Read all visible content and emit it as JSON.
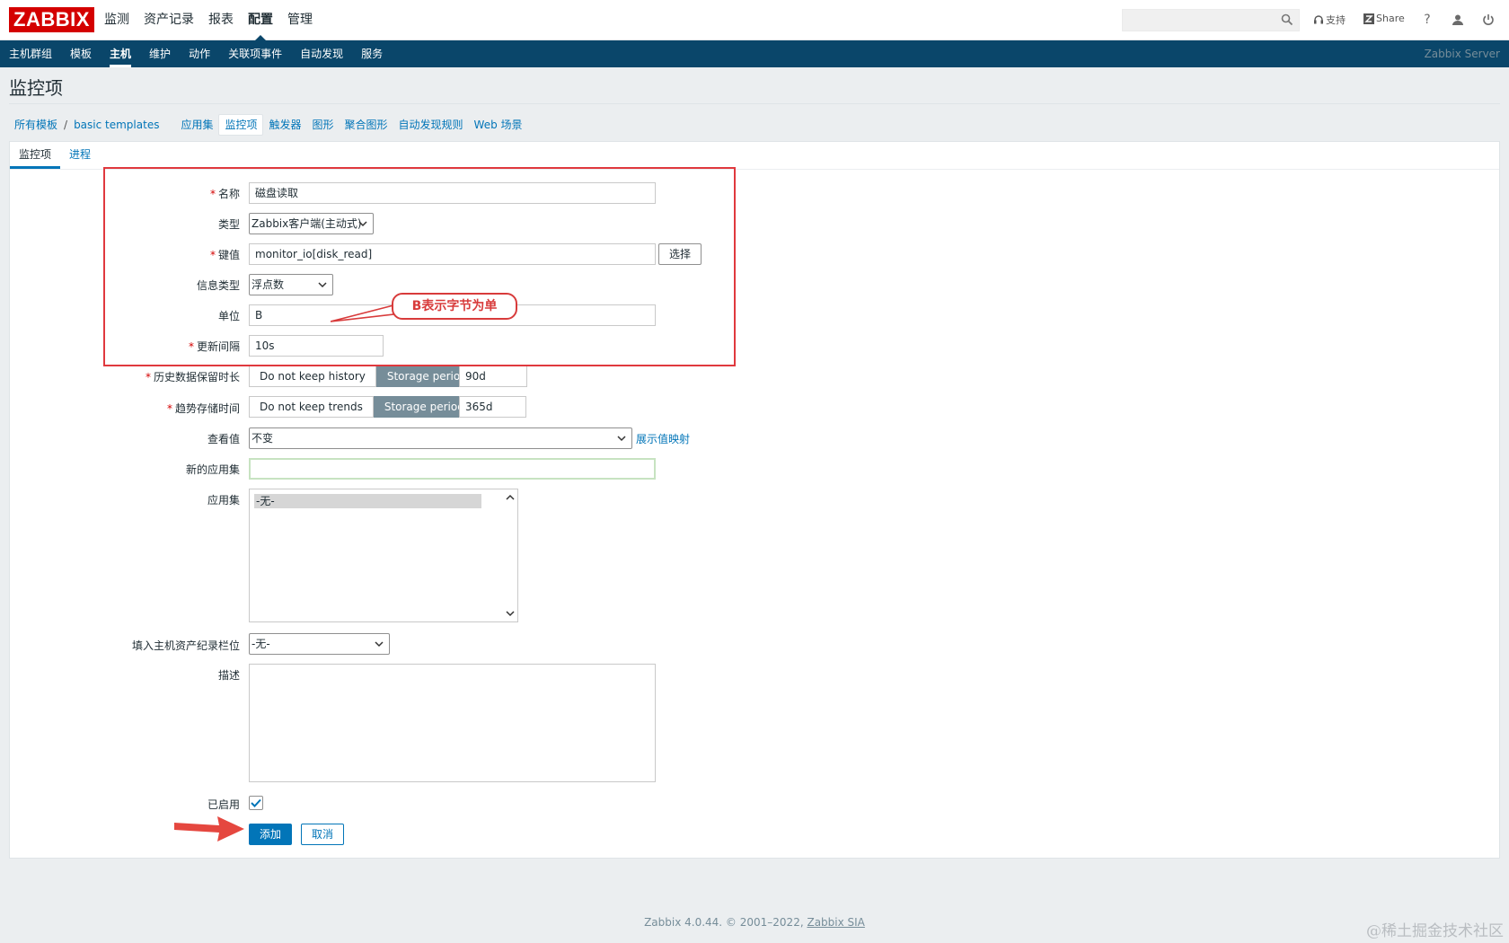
{
  "header": {
    "logo": "ZABBIX",
    "main_nav": [
      "监测",
      "资产记录",
      "报表",
      "配置",
      "管理"
    ],
    "main_nav_active": 3,
    "search_value": "",
    "support_label": "支持",
    "share_label": "Share",
    "help_label": "?"
  },
  "sub_nav": {
    "items": [
      "主机群组",
      "模板",
      "主机",
      "维护",
      "动作",
      "关联项事件",
      "自动发现",
      "服务"
    ],
    "active": 2,
    "server_name": "Zabbix Server"
  },
  "page": {
    "title": "监控项"
  },
  "breadcrumbs": {
    "root": "所有模板",
    "separator": "/",
    "template": "basic templates",
    "links": [
      "应用集",
      "监控项",
      "触发器",
      "图形",
      "聚合图形",
      "自动发现规则",
      "Web 场景"
    ],
    "current": "监控项"
  },
  "tabs": [
    "监控项",
    "进程"
  ],
  "form": {
    "name": {
      "label": "名称",
      "value": "磁盘读取",
      "required": "*"
    },
    "type": {
      "label": "类型",
      "value": "Zabbix客户端(主动式)"
    },
    "key": {
      "label": "键值",
      "value": "monitor_io[disk_read]",
      "required": "*",
      "select_button": "选择"
    },
    "info_type": {
      "label": "信息类型",
      "value": "浮点数"
    },
    "units": {
      "label": "单位",
      "value": "B"
    },
    "update_interval": {
      "label": "更新间隔",
      "value": "10s",
      "required": "*"
    },
    "history": {
      "label": "历史数据保留时长",
      "required": "*",
      "option_off": "Do not keep history",
      "option_on": "Storage period",
      "value": "90d"
    },
    "trends": {
      "label": "趋势存储时间",
      "required": "*",
      "option_off": "Do not keep trends",
      "option_on": "Storage period",
      "value": "365d"
    },
    "show_value": {
      "label": "查看值",
      "value": "不变",
      "link": "展示值映射"
    },
    "new_application": {
      "label": "新的应用集",
      "value": ""
    },
    "applications": {
      "label": "应用集",
      "options": [
        "-无-"
      ]
    },
    "inventory_field": {
      "label": "填入主机资产纪录栏位",
      "value": "-无-"
    },
    "description": {
      "label": "描述",
      "value": ""
    },
    "enabled": {
      "label": "已启用",
      "checked": true
    },
    "add_button": "添加",
    "cancel_button": "取消"
  },
  "annotation": {
    "callout_text": "B表示字节为单",
    "color": "#d83b3b"
  },
  "footer": {
    "text": "Zabbix 4.0.44. © 2001–2022,",
    "link": "Zabbix SIA"
  },
  "watermark": "@稀土掘金技术社区",
  "colors": {
    "brand_red": "#d40000",
    "nav_blue": "#0a466a",
    "link_blue": "#0275b8",
    "segment_active": "#768d99"
  }
}
